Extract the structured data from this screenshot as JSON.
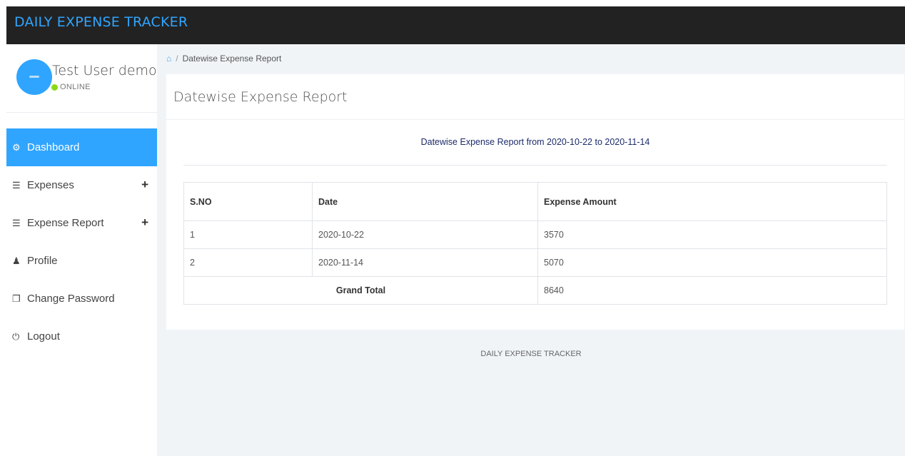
{
  "app": {
    "title": "DAILY EXPENSE TRACKER"
  },
  "user": {
    "name": "Test User demo",
    "status": "ONLINE",
    "status_color": "#8ad919"
  },
  "menu": {
    "items": [
      {
        "label": "Dashboard",
        "icon": "dashboard-icon",
        "active": true
      },
      {
        "label": "Expenses",
        "icon": "list-icon",
        "expandable": true
      },
      {
        "label": "Expense Report",
        "icon": "list-icon",
        "expandable": true
      },
      {
        "label": "Profile",
        "icon": "user-icon"
      },
      {
        "label": "Change Password",
        "icon": "copy-icon"
      },
      {
        "label": "Logout",
        "icon": "power-icon"
      }
    ],
    "expand_symbol": "+"
  },
  "breadcrumb": {
    "home_icon": "home-icon",
    "separator": "/",
    "current": "Datewise Expense Report"
  },
  "panel": {
    "heading": "Datewise Expense Report",
    "report_title": "Datewise Expense Report from 2020-10-22 to 2020-11-14"
  },
  "table": {
    "headers": [
      "S.NO",
      "Date",
      "Expense Amount"
    ],
    "rows": [
      [
        "1",
        "2020-10-22",
        "3570"
      ],
      [
        "2",
        "2020-11-14",
        "5070"
      ]
    ],
    "total_label": "Grand Total",
    "total_value": "8640"
  },
  "footer": {
    "text": "DAILY EXPENSE TRACKER"
  },
  "colors": {
    "accent": "#30a5ff",
    "topbar": "#222222",
    "content_bg": "#f1f4f7"
  }
}
